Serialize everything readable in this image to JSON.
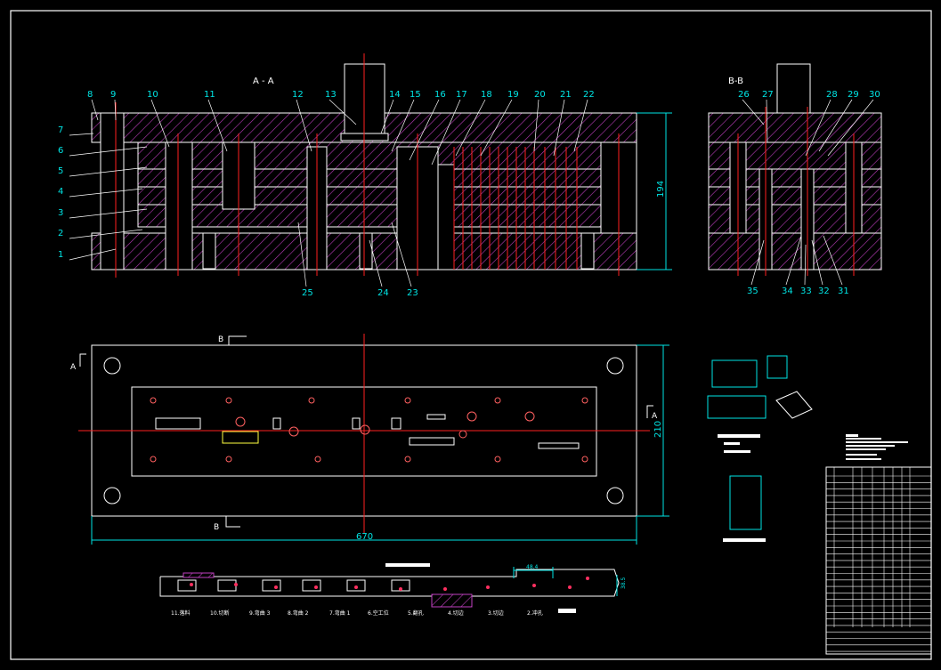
{
  "section_a": {
    "title": "A - A",
    "callouts": [
      "1",
      "2",
      "3",
      "4",
      "5",
      "6",
      "7",
      "8",
      "9",
      "10",
      "11",
      "12",
      "13",
      "14",
      "15",
      "16",
      "17",
      "18",
      "19",
      "20",
      "21",
      "22",
      "23",
      "24",
      "25"
    ],
    "height_dim": "194"
  },
  "section_b": {
    "title": "B-B",
    "callouts": [
      "26",
      "27",
      "28",
      "29",
      "30",
      "31",
      "32",
      "33",
      "34",
      "35"
    ]
  },
  "plan_view": {
    "section_a_marker": "A",
    "section_b_marker": "B",
    "width_dim": "670",
    "height_dim": "210"
  },
  "strip_layout": {
    "pitch_dim": "48.4",
    "width_dim": "38.5",
    "stations": [
      "11.落料",
      "10.切断",
      "9.弯曲 3",
      "8.弯曲 2",
      "7.弯曲 1",
      "6.空工位",
      "5.翻孔",
      "4.切边",
      "3.切边",
      "2.冲孔"
    ]
  },
  "colors": {
    "hatch": "#c040c0",
    "dimension": "#00e5e5",
    "centerline": "#ff2020",
    "outline": "#ffffff"
  }
}
